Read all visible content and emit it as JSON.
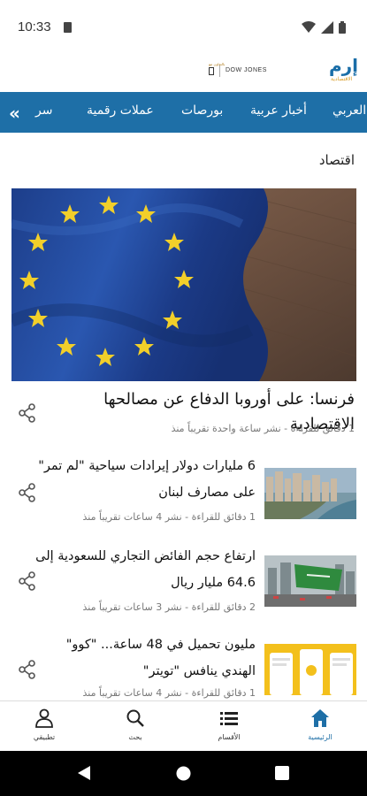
{
  "status_bar": {
    "time": "10:33"
  },
  "header": {
    "partner_tagline": "بالتعاون مع",
    "partner_name": "DOW JONES",
    "brand_name": "إرم",
    "brand_sub": "الاقتصادية"
  },
  "navbar": {
    "items": [
      "العربي",
      "أخبار عربية",
      "بورصات",
      "عملات رقمية",
      "سر"
    ]
  },
  "section": {
    "title": "اقتصاد"
  },
  "hero": {
    "title": "فرنسا: على أوروبا الدفاع عن مصالحها الاقتصادية",
    "meta": "1 دقائق للقراءة - نشر ساعة واحدة تقريباً منذ"
  },
  "articles": [
    {
      "title": "6 مليارات دولار إيرادات سياحية \"لم تمر\" على مصارف لبنان",
      "meta": "1 دقائق للقراءة - نشر 4 ساعات تقريباً منذ"
    },
    {
      "title": "ارتفاع حجم الفائض التجاري للسعودية إلى 64.6 مليار ريال",
      "meta": "2 دقائق للقراءة - نشر 3 ساعات تقريباً منذ"
    },
    {
      "title": "مليون تحميل في 48 ساعة... \"كوو\" الهندي ينافس \"تويتر\"",
      "meta": "1 دقائق للقراءة - نشر 4 ساعات تقريباً منذ"
    }
  ],
  "bottom_nav": {
    "items": [
      {
        "label": "تطبيقي",
        "icon": "person-icon"
      },
      {
        "label": "بحث",
        "icon": "search-icon"
      },
      {
        "label": "الأقسام",
        "icon": "list-icon"
      },
      {
        "label": "الرئيسية",
        "icon": "home-icon"
      }
    ],
    "active_color": "#1e6fa7"
  },
  "colors": {
    "nav_bg": "#1e6fa7",
    "brand": "#1a6ea8",
    "accent_gold": "#d89a20"
  }
}
